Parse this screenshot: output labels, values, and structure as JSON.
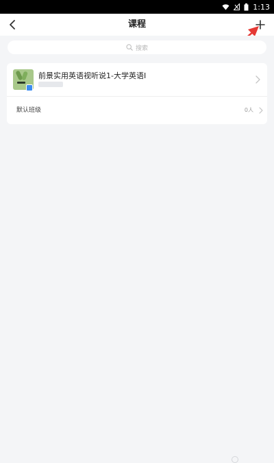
{
  "status_bar": {
    "time": "1:13"
  },
  "nav": {
    "title": "课程"
  },
  "search": {
    "placeholder": "搜索"
  },
  "course": {
    "title": "前景实用英语视听说1-大学英语I",
    "class_name": "默认班级",
    "member_count": "0人"
  },
  "colors": {
    "page_background": "#f4f5f7",
    "card_background": "#ffffff",
    "annotation_arrow": "#e53935",
    "badge": "#3b8cf0"
  },
  "icons": {
    "back": "chevron-left-icon",
    "add": "plus-icon",
    "search": "magnifier-icon",
    "row_chevron": "chevron-right-icon"
  }
}
